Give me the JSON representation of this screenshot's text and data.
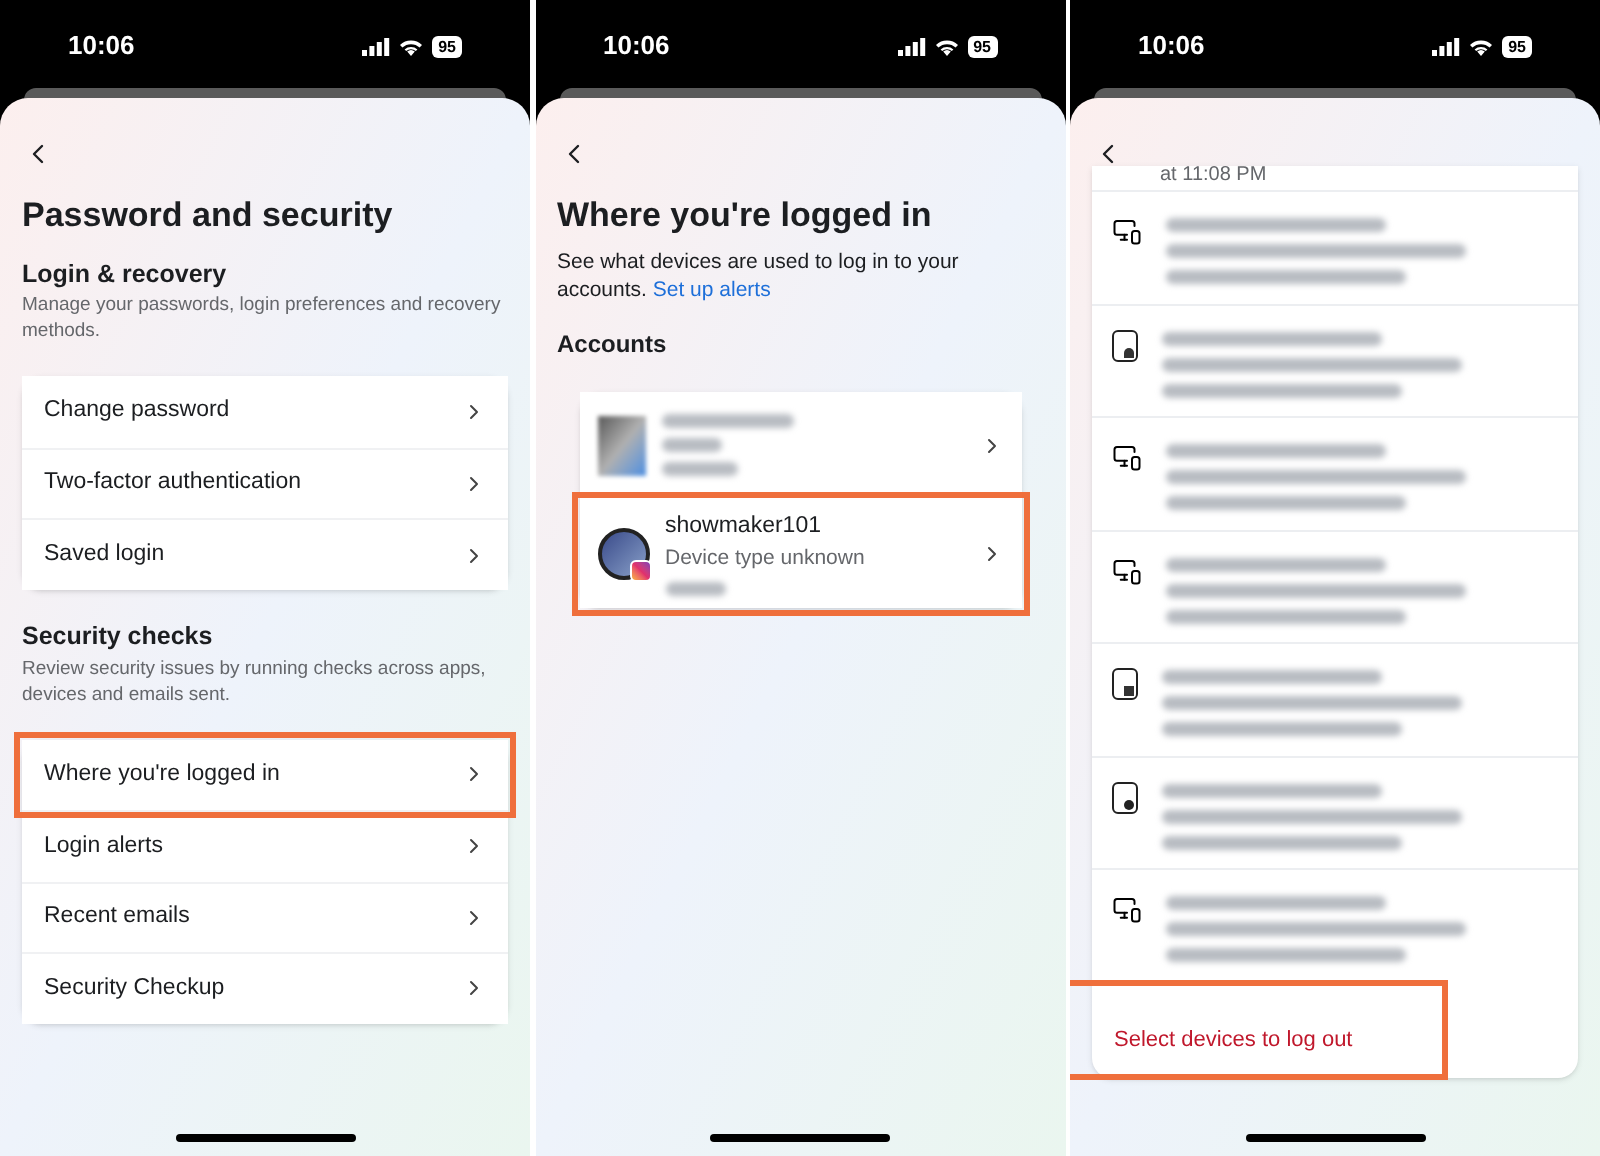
{
  "screens": [
    {
      "kind": "settings",
      "status_bar": {
        "time": "10:06",
        "battery": "95"
      },
      "title": "Password and security",
      "sections": [
        {
          "heading": "Login & recovery",
          "description": "Manage your passwords, login preferences and recovery methods.",
          "items": [
            {
              "label": "Change password",
              "highlighted": false
            },
            {
              "label": "Two-factor authentication",
              "highlighted": false
            },
            {
              "label": "Saved login",
              "highlighted": false
            }
          ]
        },
        {
          "heading": "Security checks",
          "description": "Review security issues by running checks across apps, devices and emails sent.",
          "items": [
            {
              "label": "Where you're logged in",
              "highlighted": true
            },
            {
              "label": "Login alerts",
              "highlighted": false
            },
            {
              "label": "Recent emails",
              "highlighted": false
            },
            {
              "label": "Security Checkup",
              "highlighted": false
            }
          ]
        }
      ]
    },
    {
      "kind": "accounts",
      "status_bar": {
        "time": "10:06",
        "battery": "95"
      },
      "title": "Where you're logged in",
      "description": "See what devices are used to log in to your accounts.",
      "link": "Set up alerts",
      "heading": "Accounts",
      "accounts": [
        {
          "kind": "blurred",
          "highlighted": false
        },
        {
          "kind": "account",
          "name": "showmaker101",
          "detail": "Device type unknown",
          "highlighted": true
        }
      ]
    },
    {
      "kind": "devices",
      "status_bar": {
        "time": "10:06",
        "battery": "95"
      },
      "partial_text": "at 11:08 PM",
      "devices": [
        {
          "kind": "unknown"
        },
        {
          "kind": "android"
        },
        {
          "kind": "unknown"
        },
        {
          "kind": "unknown"
        },
        {
          "kind": "windows"
        },
        {
          "kind": "apple"
        },
        {
          "kind": "unknown"
        }
      ],
      "action": {
        "label": "Select devices to log out",
        "highlighted": true
      }
    }
  ]
}
